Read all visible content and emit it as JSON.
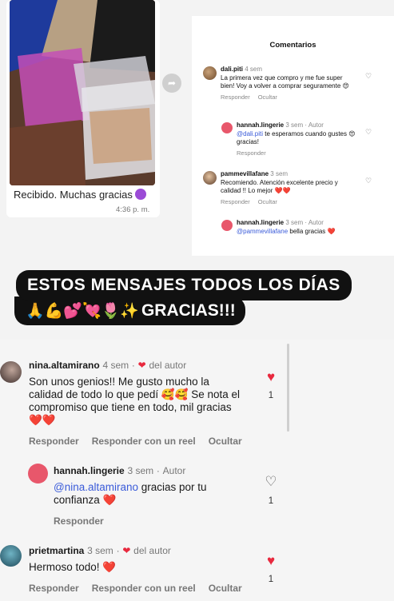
{
  "chat": {
    "message": "Recibido. Muchas gracias",
    "time": "4:36 p. m."
  },
  "panel": {
    "title": "Comentarios",
    "comments": [
      {
        "username": "dali.piti",
        "meta": "4 sem",
        "text": "La primera vez que compro y me fue super bien! Voy a volver a comprar seguramente 😍",
        "actions": [
          "Responder",
          "Ocultar"
        ]
      },
      {
        "username": "hannah.lingerie",
        "meta": "3 sem · Autor",
        "mention": "@dali.piti",
        "text": " te esperamos cuando gustes 😍 gracias!",
        "actions": [
          "Responder"
        ]
      },
      {
        "username": "pammevillafane",
        "meta": "3 sem",
        "text": "Recomiendo. Atención excelente precio y calidad !! Lo mejor ❤️❤️",
        "actions": [
          "Responder",
          "Ocultar"
        ]
      },
      {
        "username": "hannah.lingerie",
        "meta": "3 sem · Autor",
        "mention": "@pammevillafane",
        "text": " bella gracias ❤️"
      }
    ]
  },
  "banner": {
    "line1": "ESTOS MENSAJES  TODOS LOS DÍAS",
    "line2_emojis": "🙏💪💕💘🌷✨",
    "line2_text": "GRACIAS!!!"
  },
  "comments": [
    {
      "username": "nina.altamirano",
      "time": "4 sem",
      "badge": "del autor",
      "text": "Son unos genios!! Me gusto mucho la calidad de todo lo que pedí 🥰🥰 Se nota el compromiso que tiene en todo, mil gracias ❤️❤️",
      "actions": [
        "Responder",
        "Responder con un reel",
        "Ocultar"
      ],
      "likes": "1"
    },
    {
      "username": "hannah.lingerie",
      "time": "3 sem",
      "badge": "Autor",
      "mention": "@nina.altamirano",
      "text": " gracias por tu confianza ❤️",
      "actions": [
        "Responder"
      ],
      "likes": "1"
    },
    {
      "username": "prietmartina",
      "time": "3 sem",
      "badge": "del autor",
      "text": "Hermoso todo! ❤️",
      "actions": [
        "Responder",
        "Responder con un reel",
        "Ocultar"
      ],
      "likes": "1"
    }
  ],
  "colors": {
    "like_red": "#e8293e",
    "mention_blue": "#3a5bd9",
    "banner_bg": "#111111"
  }
}
